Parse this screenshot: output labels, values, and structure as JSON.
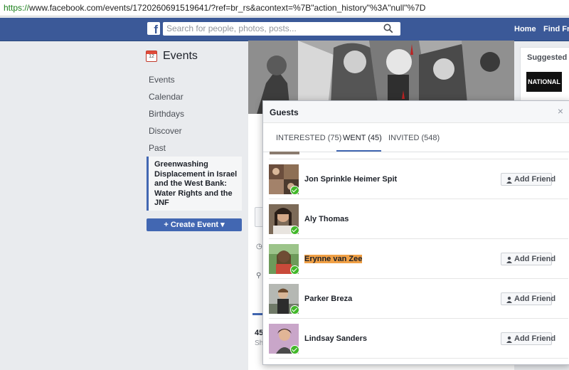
{
  "browser": {
    "url_scheme": "https://",
    "url_rest": "www.facebook.com/events/1720260691519641/?ref=br_rs&acontext=%7B\"action_history\"%3A\"null\"%7D"
  },
  "topbar": {
    "logo": "f",
    "search_placeholder": "Search for people, photos, posts...",
    "nav_home": "Home",
    "nav_find_friends": "Find Frie"
  },
  "sidebar": {
    "title": "Events",
    "calendar_day": "12",
    "items": [
      "Events",
      "Calendar",
      "Birthdays",
      "Discover",
      "Past"
    ],
    "active_event": "Greenwashing Displacement in Israel and the West Bank: Water Rights and the JNF",
    "create_event": "+ Create Event ▾"
  },
  "right_column": {
    "label": "Suggested Ev",
    "thumb_text": "NATIONAL"
  },
  "background": {
    "count": "45",
    "sub": "Sh"
  },
  "modal": {
    "title": "Guests",
    "close": "×",
    "tabs": [
      {
        "label": "INTERESTED (75)",
        "selected": false
      },
      {
        "label": "WENT (45)",
        "selected": true
      },
      {
        "label": "INVITED (548)",
        "selected": false
      }
    ],
    "add_friend_label": "Add Friend",
    "guests": [
      {
        "name": "Jon Sprinkle Heimer Spit",
        "add_friend": true,
        "highlighted": false
      },
      {
        "name": "Aly Thomas",
        "add_friend": false,
        "highlighted": false
      },
      {
        "name": "Erynne van Zee",
        "add_friend": true,
        "highlighted": true
      },
      {
        "name": "Parker Breza",
        "add_friend": true,
        "highlighted": false
      },
      {
        "name": "Lindsay Sanders",
        "add_friend": true,
        "highlighted": false
      }
    ]
  },
  "colors": {
    "facebook_blue": "#3b5998",
    "button_blue": "#4267b2",
    "highlight": "#f0a046",
    "check_green": "#42b72a"
  }
}
